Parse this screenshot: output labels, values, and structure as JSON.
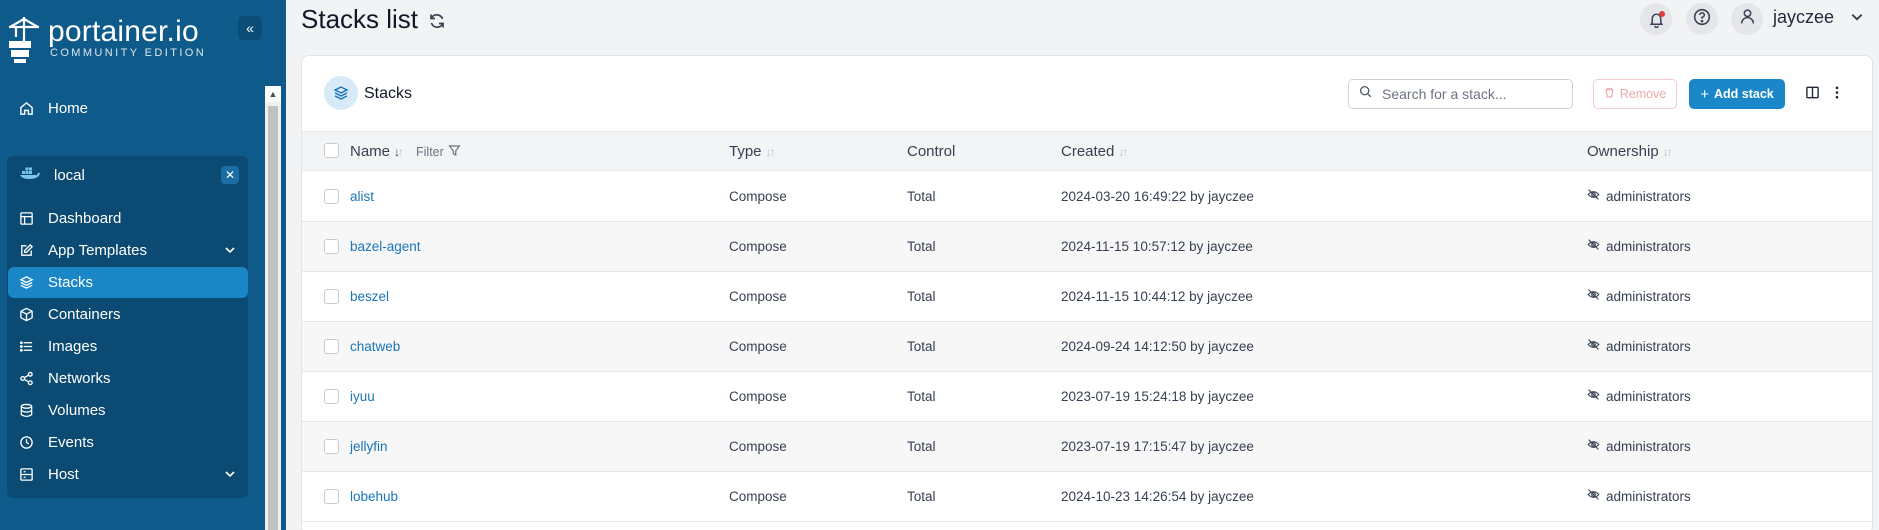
{
  "app": {
    "logo_text": "portainer.io",
    "logo_sub": "COMMUNITY EDITION"
  },
  "sidebar": {
    "home_label": "Home",
    "environment": {
      "name": "local"
    },
    "items": [
      {
        "label": "Dashboard",
        "icon": "dashboard-icon"
      },
      {
        "label": "App Templates",
        "icon": "edit-icon",
        "expandable": true
      },
      {
        "label": "Stacks",
        "icon": "layers-icon",
        "active": true
      },
      {
        "label": "Containers",
        "icon": "box-icon"
      },
      {
        "label": "Images",
        "icon": "list-icon"
      },
      {
        "label": "Networks",
        "icon": "share-icon"
      },
      {
        "label": "Volumes",
        "icon": "database-icon"
      },
      {
        "label": "Events",
        "icon": "clock-icon"
      },
      {
        "label": "Host",
        "icon": "host-icon",
        "expandable": true
      }
    ]
  },
  "header": {
    "title": "Stacks list",
    "user": "jayczee"
  },
  "card": {
    "title": "Stacks",
    "search_placeholder": "Search for a stack...",
    "remove_label": "Remove",
    "add_label": "Add stack"
  },
  "table": {
    "columns": {
      "name": "Name",
      "filter": "Filter",
      "type": "Type",
      "control": "Control",
      "created": "Created",
      "ownership": "Ownership"
    },
    "rows": [
      {
        "name": "alist",
        "type": "Compose",
        "control": "Total",
        "created": "2024-03-20 16:49:22 by jayczee",
        "ownership": "administrators"
      },
      {
        "name": "bazel-agent",
        "type": "Compose",
        "control": "Total",
        "created": "2024-11-15 10:57:12 by jayczee",
        "ownership": "administrators"
      },
      {
        "name": "beszel",
        "type": "Compose",
        "control": "Total",
        "created": "2024-11-15 10:44:12 by jayczee",
        "ownership": "administrators"
      },
      {
        "name": "chatweb",
        "type": "Compose",
        "control": "Total",
        "created": "2024-09-24 14:12:50 by jayczee",
        "ownership": "administrators"
      },
      {
        "name": "iyuu",
        "type": "Compose",
        "control": "Total",
        "created": "2023-07-19 15:24:18 by jayczee",
        "ownership": "administrators"
      },
      {
        "name": "jellyfin",
        "type": "Compose",
        "control": "Total",
        "created": "2023-07-19 17:15:47 by jayczee",
        "ownership": "administrators"
      },
      {
        "name": "lobehub",
        "type": "Compose",
        "control": "Total",
        "created": "2024-10-23 14:26:54 by jayczee",
        "ownership": "administrators"
      }
    ]
  },
  "colors": {
    "sidebar_bg": "#0e5a8a",
    "active_item": "#1b86c6",
    "accent_blue": "#1a87c8",
    "link_blue": "#1a75b8"
  }
}
